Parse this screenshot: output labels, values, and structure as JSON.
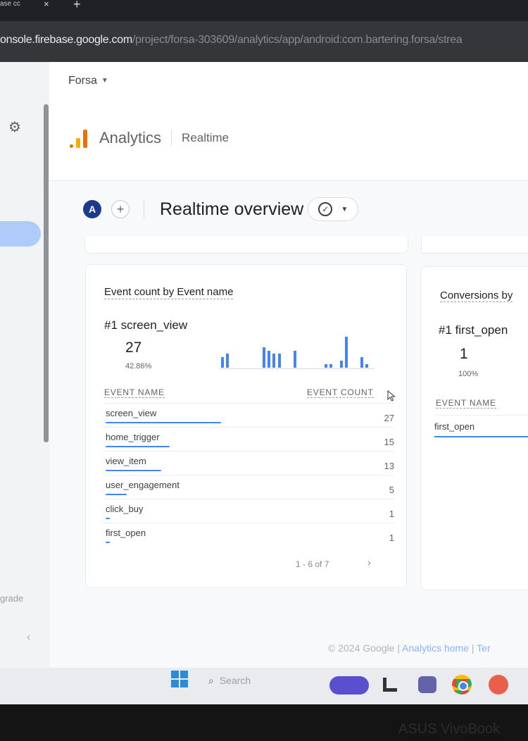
{
  "browser": {
    "tab_title": "ase cc",
    "url_host": "onsole.firebase.google.com",
    "url_path": "/project/forsa-303609/analytics/app/android:com.bartering.forsa/strea"
  },
  "sidebar": {
    "footer_text": "grade"
  },
  "project_selector": {
    "label": "Forsa"
  },
  "brand": {
    "product": "Analytics",
    "section": "Realtime"
  },
  "toolbar": {
    "avatar_letter": "A",
    "page_title": "Realtime overview"
  },
  "event_card": {
    "title": "Event count by Event name",
    "top_event": "#1 screen_view",
    "top_count": "27",
    "top_percent": "42.86%",
    "col_name": "EVENT NAME",
    "col_count": "EVENT COUNT",
    "rows": [
      {
        "name": "screen_view",
        "count": "27",
        "share": 1.0
      },
      {
        "name": "home_trigger",
        "count": "15",
        "share": 0.556
      },
      {
        "name": "view_item",
        "count": "13",
        "share": 0.481
      },
      {
        "name": "user_engagement",
        "count": "5",
        "share": 0.185
      },
      {
        "name": "click_buy",
        "count": "1",
        "share": 0.037
      },
      {
        "name": "first_open",
        "count": "1",
        "share": 0.037
      }
    ],
    "pagination": "1 - 6 of 7"
  },
  "chart_data": {
    "type": "bar",
    "values": [
      3,
      4,
      0,
      0,
      0,
      0,
      0,
      0,
      6,
      5,
      4,
      4,
      0,
      0,
      5,
      0,
      0,
      0,
      0,
      0,
      1,
      1,
      0,
      2,
      9,
      0,
      0,
      3,
      1,
      0
    ],
    "color": "#4285f4"
  },
  "conversions_card": {
    "title": "Conversions by",
    "top_event": "#1 first_open",
    "top_count": "1",
    "top_percent": "100%",
    "col_name": "EVENT NAME",
    "row_name": "first_open"
  },
  "footer": {
    "copyright": "© 2024 Google",
    "link1": "Analytics home",
    "link2": "Ter"
  },
  "taskbar": {
    "search_placeholder": "Search"
  },
  "device": {
    "brand": "ASUS VivoBook"
  }
}
